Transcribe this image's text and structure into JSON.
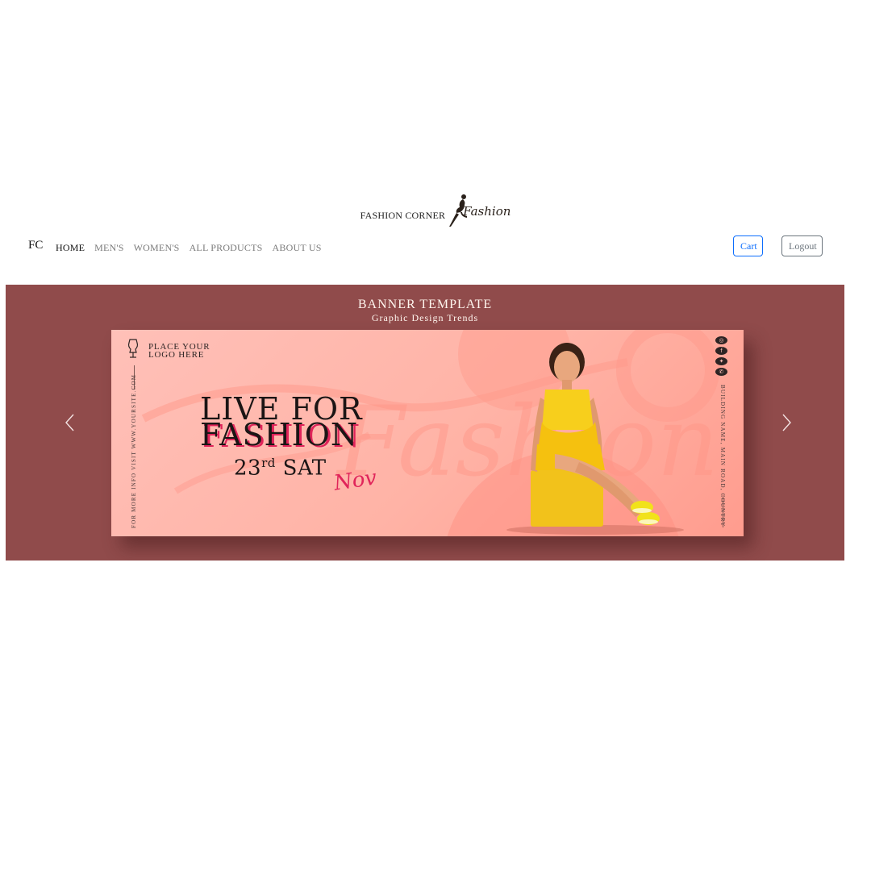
{
  "brand": {
    "name": "FASHION CORNER",
    "logo_script": "Fashion"
  },
  "navbar": {
    "brand": "FC",
    "links": [
      {
        "label": "HOME",
        "active": true
      },
      {
        "label": "MEN'S",
        "active": false
      },
      {
        "label": "WOMEN'S",
        "active": false
      },
      {
        "label": "ALL PRODUCTS",
        "active": false
      },
      {
        "label": "ABOUT US",
        "active": false
      }
    ],
    "cart_label": "Cart",
    "logout_label": "Logout"
  },
  "carousel": {
    "background_color": "#904b4b",
    "title": "BANNER TEMPLATE",
    "subtitle": "Graphic Design Trends",
    "prev_icon": "chevron-left-icon",
    "next_icon": "chevron-right-icon",
    "banner": {
      "logo_placeholder": "PLACE YOUR LOGO HERE",
      "left_vertical_text": "FOR MORE INFO VISIT WWW.YOURSITE.COM",
      "right_vertical_text": "BUILDING NAME, MAIN ROAD, COUNTRY",
      "headline_line1": "LIVE FOR",
      "headline_line2": "FASHION",
      "date_number": "23",
      "date_suffix": "rd",
      "date_day": "SAT",
      "month_script": "Nov",
      "background_script": "Fashion",
      "accent_color": "#e0245a",
      "social_icons": [
        "instagram-icon",
        "facebook-icon",
        "twitter-icon",
        "whatsapp-icon"
      ]
    }
  }
}
